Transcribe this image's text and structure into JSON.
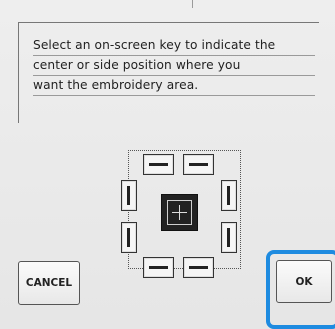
{
  "message": {
    "line1": "Select an on-screen key to indicate the",
    "line2": "center or side position where you",
    "line3": "want the embroidery area."
  },
  "buttons": {
    "cancel_label": "CANCEL",
    "ok_label": "OK"
  },
  "colors": {
    "highlight": "#1e8be0"
  }
}
